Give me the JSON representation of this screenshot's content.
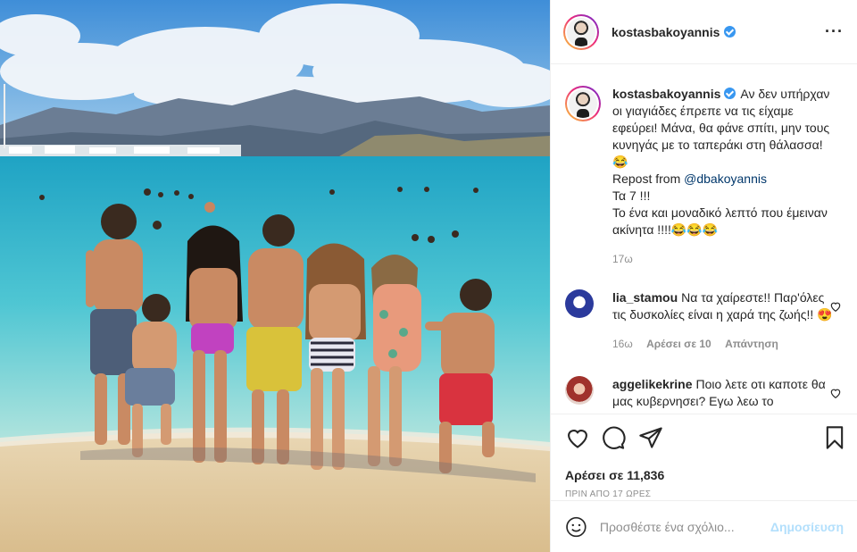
{
  "post": {
    "username": "kostasbakoyannis",
    "verified_icon": "verified-badge-icon",
    "more_icon": "more-options-icon"
  },
  "caption": {
    "username": "kostasbakoyannis",
    "lines": [
      "Αν δεν υπήρχαν οι γιαγιάδες έπρεπε να τις είχαμε εφεύρει! Μάνα, θα φάνε σπίτι, μην τους κυνηγάς με το ταπεράκι στη θάλασσα! 😂",
      "Repost from ",
      "@dbakoyannis",
      "Τα 7 !!!",
      "Το ένα και μοναδικό λεπτό που έμειναν ακίνητα !!!!😂😂😂"
    ],
    "age": "17ω"
  },
  "comments": [
    {
      "username": "lia_stamou",
      "text": "Να τα χαίρεστε!! Παρ'όλες τις δυσκολίες είναι η χαρά της ζωής!! 😍",
      "age": "16ω",
      "likes": "Αρέσει σε 10",
      "reply": "Απάντηση"
    },
    {
      "username": "aggelikekrine",
      "text": "Ποιο λετε οτι καποτε θα μας κυβερνησει? Εγω λεω το",
      "age": "",
      "likes": "",
      "reply": ""
    }
  ],
  "actions": {
    "likes": "Αρέσει σε 11,836",
    "timestamp": "ΠΡΙΝ ΑΠΟ 17 ΩΡΕΣ",
    "icons": [
      "heart-icon",
      "comment-icon",
      "share-icon",
      "bookmark-icon"
    ]
  },
  "comment_box": {
    "placeholder": "Προσθέστε ένα σχόλιο...",
    "post_label": "Δημοσίευση",
    "post_color": "#b2dffc"
  },
  "colors": {
    "text": "#262626",
    "secondary": "#8e8e8e",
    "link": "#00376b",
    "verified": "#3897f0",
    "divider": "#efefef"
  }
}
